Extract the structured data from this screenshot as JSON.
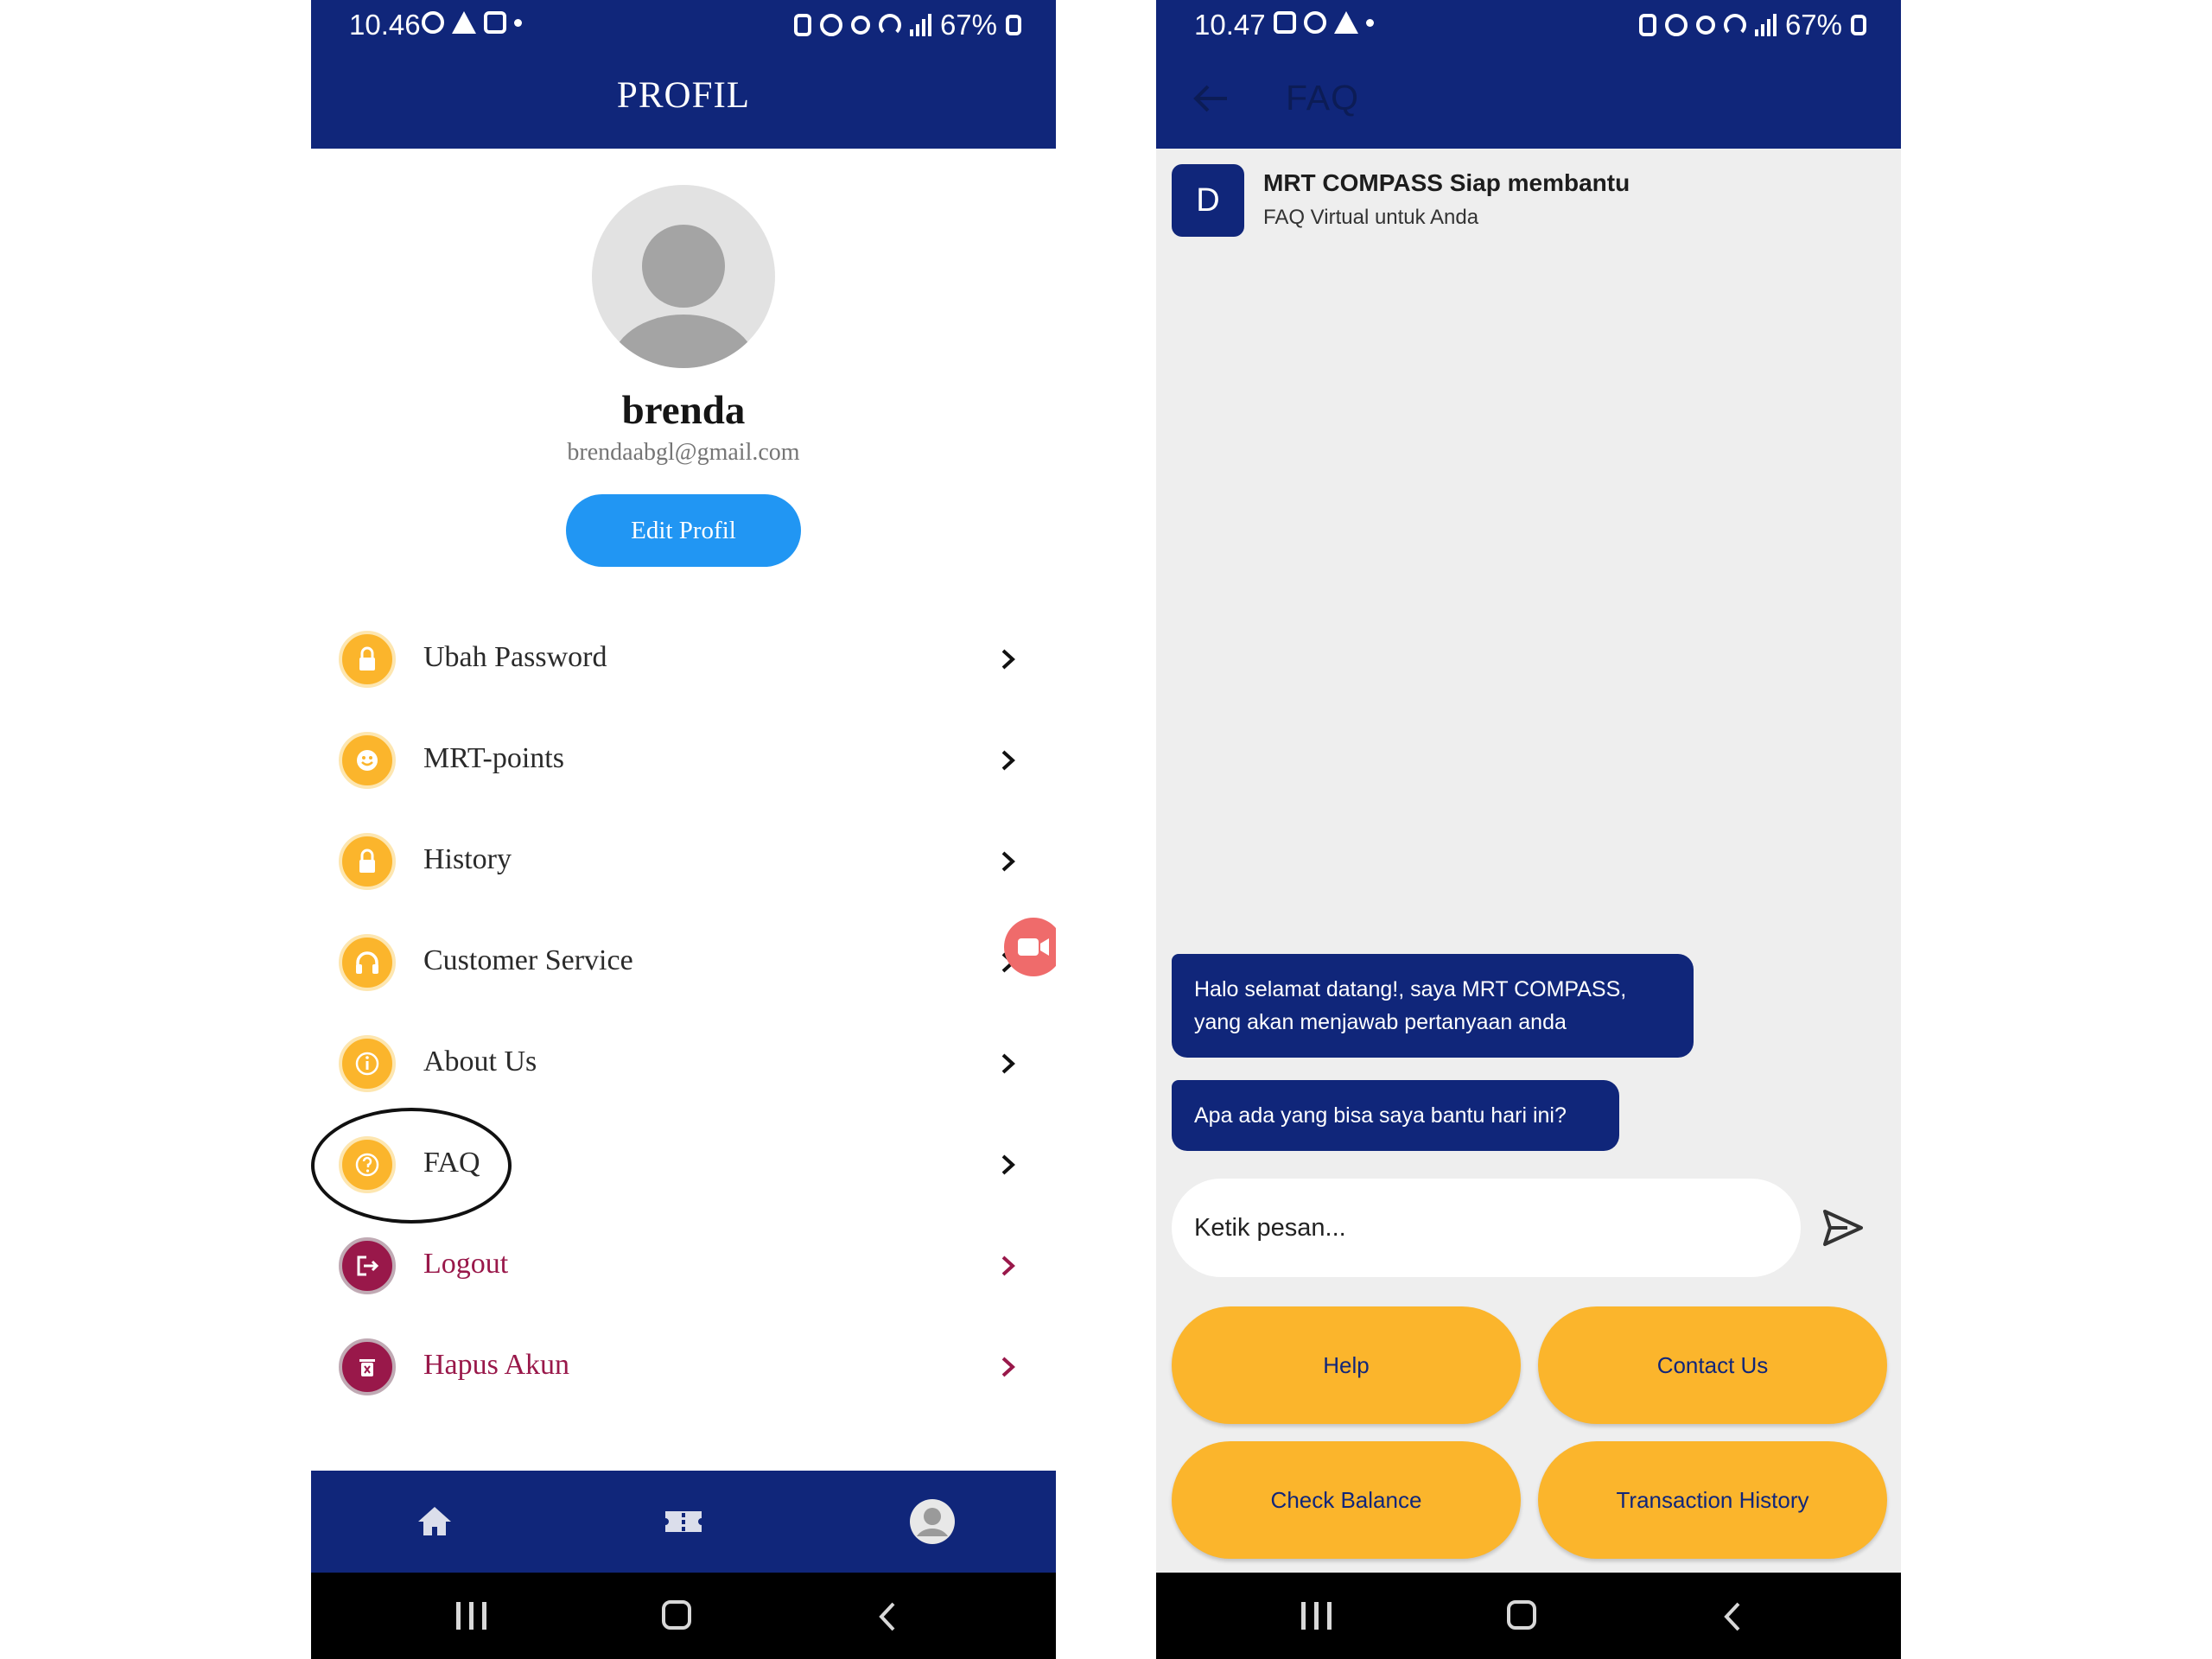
{
  "profile_screen": {
    "status_bar": {
      "time": "10.46",
      "battery": "67%"
    },
    "title": "PROFIL",
    "user": {
      "name": "brenda",
      "email": "brendaabgl@gmail.com"
    },
    "edit_button": "Edit Profil",
    "menu": [
      {
        "label": "Ubah Password",
        "icon": "lock-icon"
      },
      {
        "label": "MRT-points",
        "icon": "smiley-icon"
      },
      {
        "label": "History",
        "icon": "lock-icon"
      },
      {
        "label": "Customer Service",
        "icon": "headset-icon"
      },
      {
        "label": "About Us",
        "icon": "info-icon"
      },
      {
        "label": "FAQ",
        "icon": "question-icon"
      },
      {
        "label": "Logout",
        "icon": "logout-icon"
      },
      {
        "label": "Hapus Akun",
        "icon": "trash-icon"
      }
    ],
    "bottom_nav": [
      "home-icon",
      "ticket-icon",
      "profile-avatar-icon"
    ]
  },
  "faq_screen": {
    "status_bar": {
      "time": "10.47",
      "battery": "67%"
    },
    "title": "FAQ",
    "bot": {
      "avatar_letter": "D",
      "name": "MRT COMPASS Siap membantu",
      "subtitle": "FAQ Virtual untuk Anda"
    },
    "messages": [
      {
        "line1": "Halo selamat datang!, saya MRT COMPASS,",
        "line2": "yang akan menjawab pertanyaan anda"
      },
      {
        "line1": "Apa ada yang bisa saya bantu hari ini?"
      }
    ],
    "input_placeholder": "Ketik pesan...",
    "quick_replies": [
      "Help",
      "Contact Us",
      "Check Balance",
      "Transaction History"
    ]
  },
  "colors": {
    "navy": "#10267a",
    "accent_yellow": "#fbb52c",
    "danger": "#99184a",
    "primary_blue": "#2196f3"
  }
}
